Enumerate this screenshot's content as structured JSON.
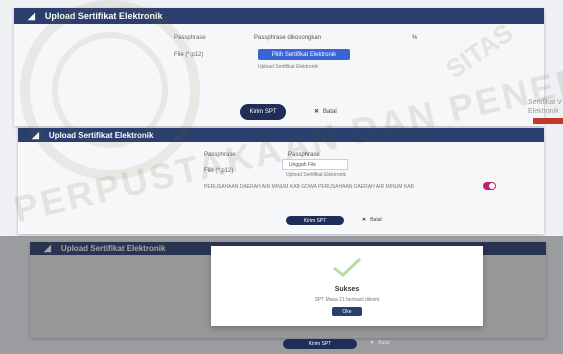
{
  "panel1": {
    "title": "Upload Sertifikat Elektronik",
    "passphrase_label": "Passphrase",
    "passphrase_value": "Passphrase dikosongkan",
    "passphrase_suffix": "%",
    "file_label": "File (*.p12)",
    "choose_button": "Pilih Sertifikat Elektronik",
    "file_hint": "Upload Sertifikat Elektronik",
    "submit_button": "Kirim SPT",
    "cancel_button": "Batal"
  },
  "side": {
    "line1": "Sertifikat V",
    "line2": "Elektronik"
  },
  "panel2": {
    "title": "Upload Sertifikat Elektronik",
    "passphrase_label": "Passphrase",
    "passphrase_value": "Passphrase",
    "file_label": "File (*.p12)",
    "file_button": "Unggah File",
    "file_hint": "Upload Sertifikat Elektronik",
    "statement": "PERUSAHAAN DAERAH AIR MINUM KAB GOWA PERUSAHAAN DAERAH AIR MINUM KAB",
    "submit_button": "Kirim SPT",
    "cancel_button": "Batal"
  },
  "panel3": {
    "title": "Upload Sertifikat Elektronik",
    "submit_button": "Kirim SPT",
    "cancel_button": "Batal"
  },
  "modal": {
    "title": "Sukses",
    "message": "SPT Masa 21 berhasil dikirim",
    "ok_button": "Oke"
  },
  "watermark": {
    "line1": "PERPUSTAKAAN DAN PENERBITAN",
    "line2": "SITAS"
  },
  "colors": {
    "header": "#2a3f6d",
    "primary_button": "#1f2e58",
    "choose_button": "#3a63d8",
    "toggle": "#c21e6f"
  }
}
